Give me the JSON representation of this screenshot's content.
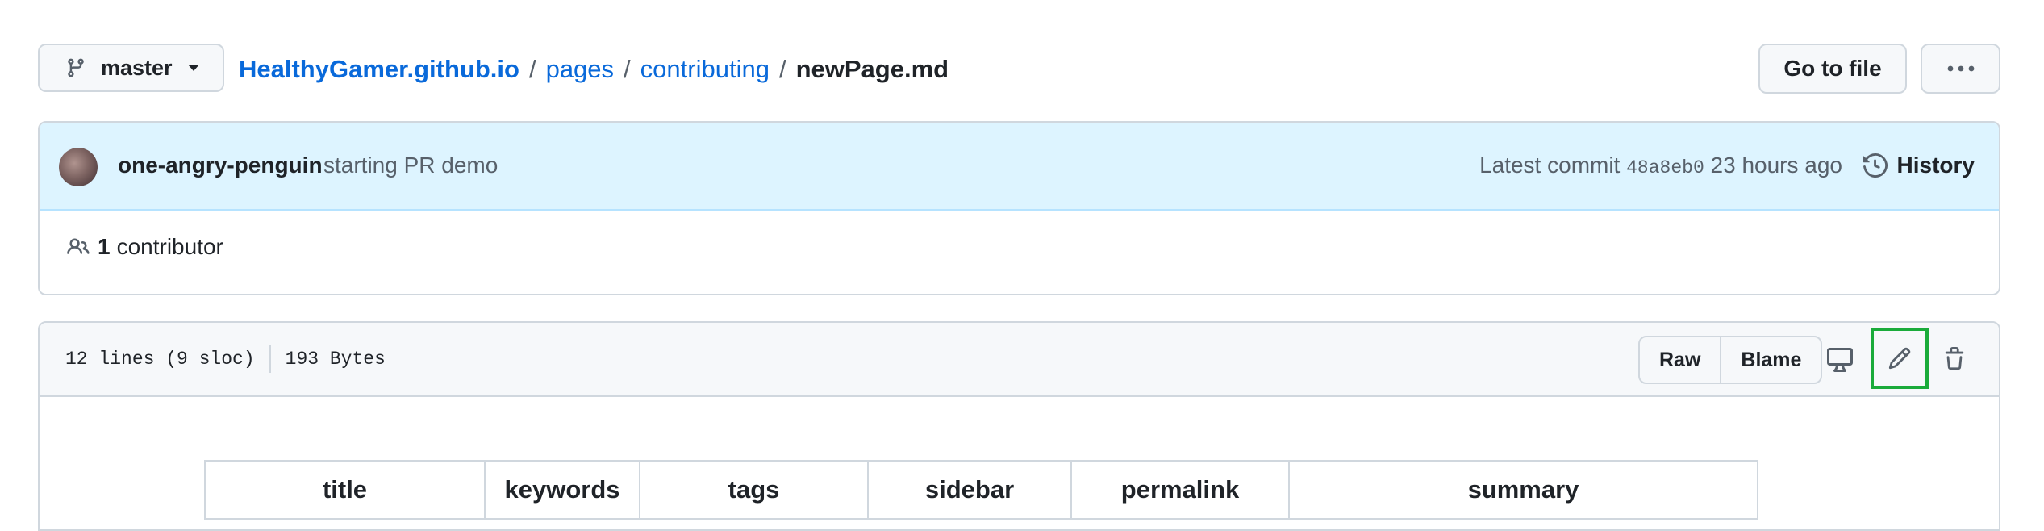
{
  "branch": {
    "name": "master"
  },
  "breadcrumb": {
    "repo": "HealthyGamer.github.io",
    "separator": "/",
    "folder1": "pages",
    "folder2": "contributing",
    "file": "newPage.md"
  },
  "actions": {
    "go_to_file": "Go to file",
    "more": "more-horizontal-icon"
  },
  "commit": {
    "author": "one-angry-penguin",
    "message": "starting PR demo",
    "latest_label": "Latest commit",
    "sha": "48a8eb0",
    "time": "23 hours ago",
    "history_label": "History"
  },
  "contributors": {
    "count": "1",
    "label": "contributor"
  },
  "file": {
    "lines": "12 lines (9 sloc)",
    "size": "193 Bytes",
    "raw_label": "Raw",
    "blame_label": "Blame"
  },
  "table": {
    "headers": [
      "title",
      "keywords",
      "tags",
      "sidebar",
      "permalink",
      "summary"
    ]
  },
  "colors": {
    "link": "#0969da",
    "highlight": "#1aab3a",
    "commit_bg": "#ddf4ff"
  }
}
